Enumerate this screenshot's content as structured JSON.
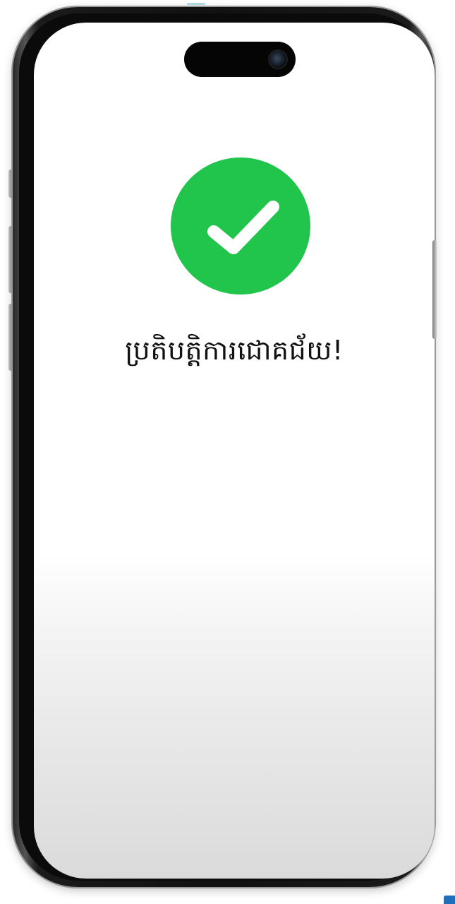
{
  "device": {
    "type": "smartphone",
    "frame_color": "#111111",
    "screen_background": "#ffffff"
  },
  "success": {
    "icon": "checkmark-icon",
    "icon_color": "#21c54c",
    "message": "ប្រតិបត្តិការជោគជ័យ!"
  }
}
